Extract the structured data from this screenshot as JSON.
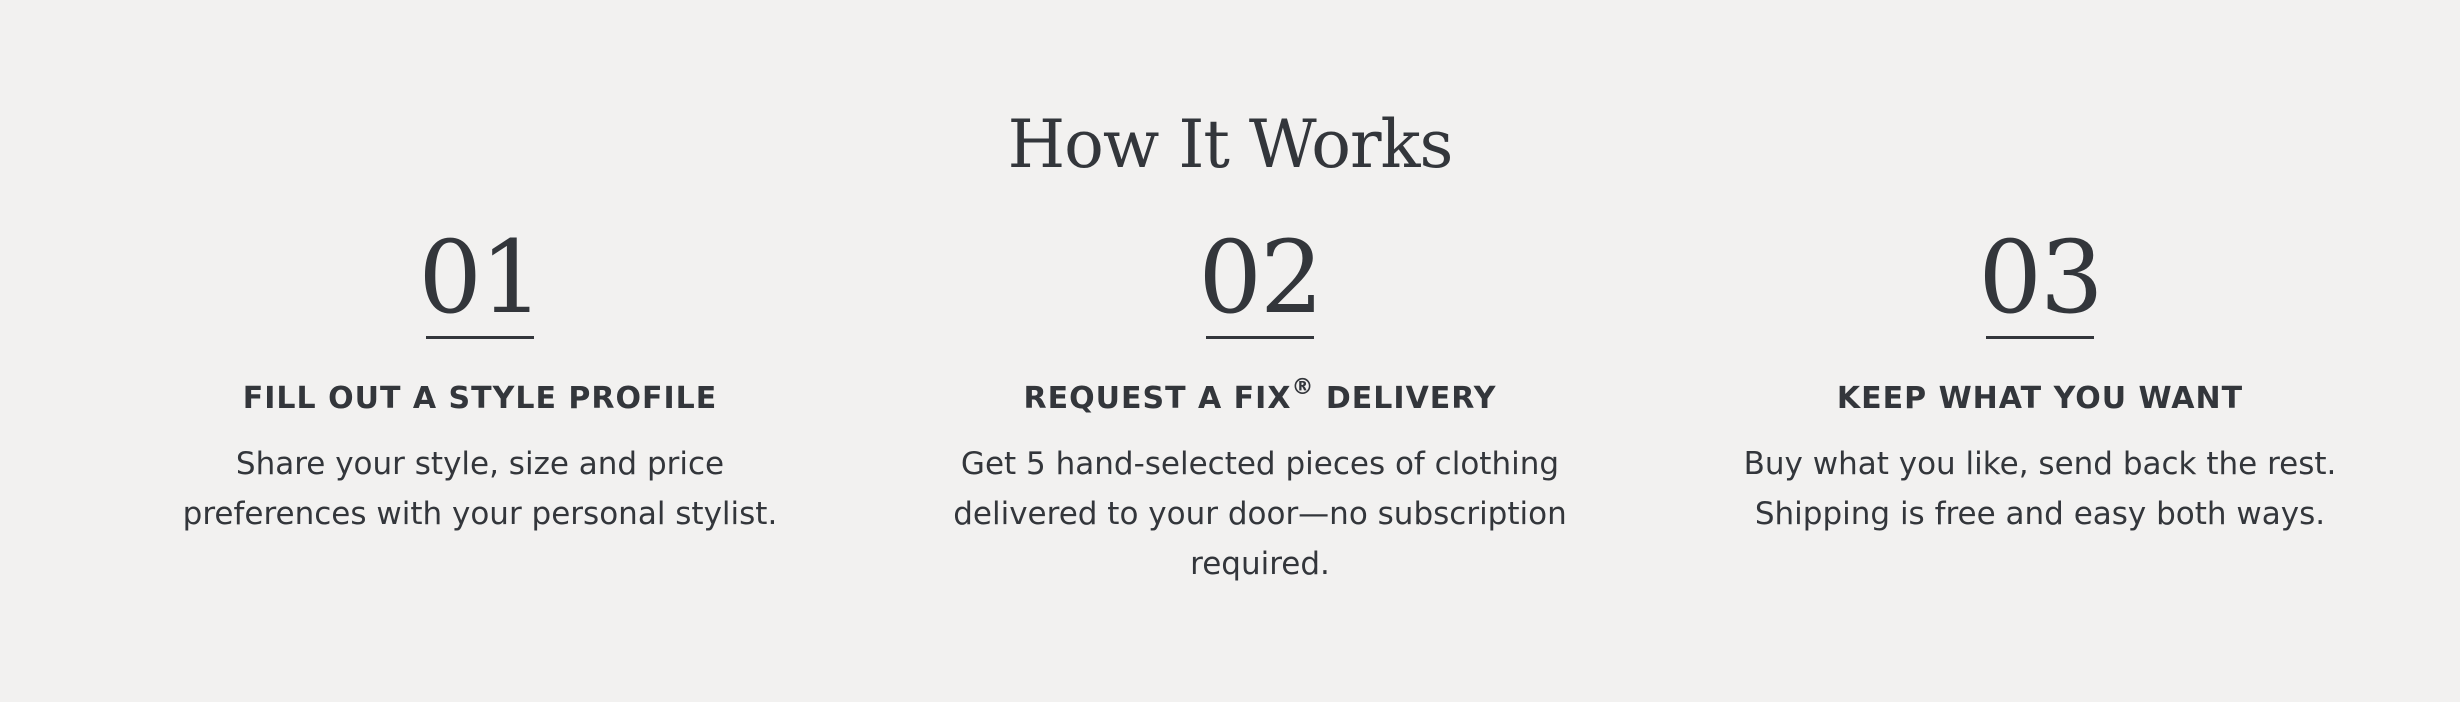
{
  "section": {
    "title": "How It Works"
  },
  "steps": [
    {
      "number": "01",
      "heading": "FILL OUT A STYLE PROFILE",
      "description": "Share your style, size and price preferences with your personal stylist."
    },
    {
      "number": "02",
      "heading_pre": "REQUEST A FIX",
      "heading_mark": "®",
      "heading_post": " DELIVERY",
      "description": "Get 5 hand-selected pieces of clothing delivered to your door—no subscription required."
    },
    {
      "number": "03",
      "heading": "KEEP WHAT YOU WANT",
      "description": "Buy what you like, send back the rest. Shipping is free and easy both ways."
    }
  ],
  "colors": {
    "background": "#f2f1f0",
    "text": "#33363b"
  }
}
